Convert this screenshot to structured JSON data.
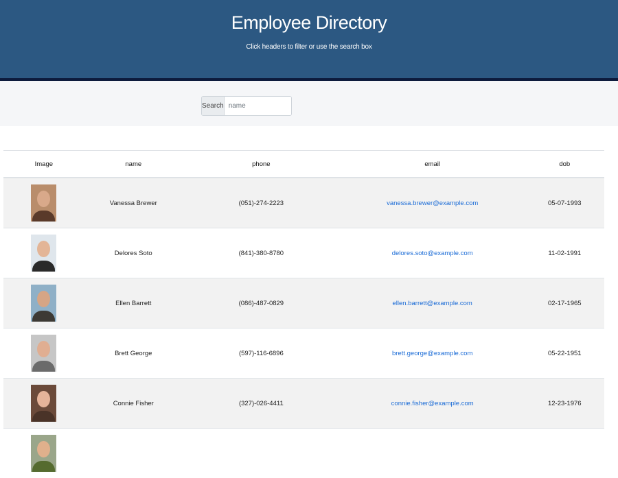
{
  "header": {
    "title": "Employee Directory",
    "subtitle": "Click headers to filter or use the search box",
    "background": "#2c5882"
  },
  "search": {
    "label": "Search",
    "placeholder": "name",
    "value": ""
  },
  "table": {
    "columns": [
      "Image",
      "name",
      "phone",
      "email",
      "dob"
    ],
    "rows": [
      {
        "name": "Vanessa Brewer",
        "phone": "(051)-274-2223",
        "email": "vanessa.brewer@example.com",
        "dob": "05-07-1993",
        "avatar": {
          "bg": "#b98d6b",
          "skin": "#d9a98a",
          "shirt": "#5a3a2a"
        }
      },
      {
        "name": "Delores Soto",
        "phone": "(841)-380-8780",
        "email": "delores.soto@example.com",
        "dob": "11-02-1991",
        "avatar": {
          "bg": "#dfe6ec",
          "skin": "#e3b597",
          "shirt": "#2a2a2a"
        }
      },
      {
        "name": "Ellen Barrett",
        "phone": "(086)-487-0829",
        "email": "ellen.barrett@example.com",
        "dob": "02-17-1965",
        "avatar": {
          "bg": "#8fb0c7",
          "skin": "#d6a585",
          "shirt": "#3d3a35"
        }
      },
      {
        "name": "Brett George",
        "phone": "(597)-116-6896",
        "email": "brett.george@example.com",
        "dob": "05-22-1951",
        "avatar": {
          "bg": "#c6c6c6",
          "skin": "#e0ae92",
          "shirt": "#6b6b6b"
        }
      },
      {
        "name": "Connie Fisher",
        "phone": "(327)-026-4411",
        "email": "connie.fisher@example.com",
        "dob": "12-23-1976",
        "avatar": {
          "bg": "#6b4a3a",
          "skin": "#e6b49a",
          "shirt": "#4a3328"
        }
      },
      {
        "name": "",
        "phone": "",
        "email": "",
        "dob": "",
        "avatar": {
          "bg": "#9aa68a",
          "skin": "#e0b08c",
          "shirt": "#556b2f"
        }
      }
    ]
  },
  "colors": {
    "link": "#1a6bd6",
    "stripe": "#f2f2f2"
  }
}
